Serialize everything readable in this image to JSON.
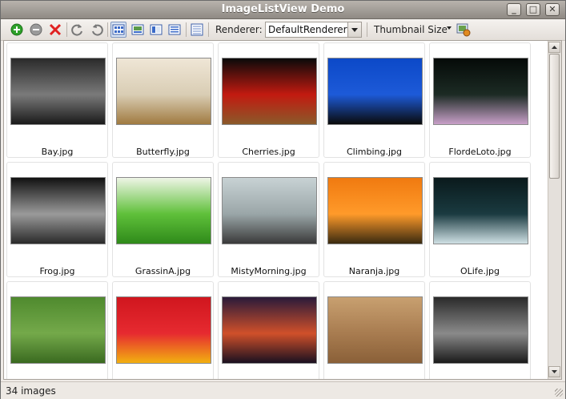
{
  "window": {
    "title": "ImageListView Demo",
    "controls": [
      "_",
      "□",
      "✕"
    ]
  },
  "toolbar": {
    "buttons": [
      {
        "name": "add-button",
        "icon": "plus-circle-icon",
        "color": "#2ea12a"
      },
      {
        "name": "remove-button",
        "icon": "minus-circle-icon",
        "color": "#8c8c8c"
      },
      {
        "name": "clear-button",
        "icon": "red-x-icon",
        "color": "#e02020"
      },
      {
        "name": "rotate-ccw-button",
        "icon": "rotate-ccw-icon",
        "color": "#777777"
      },
      {
        "name": "rotate-cw-button",
        "icon": "rotate-cw-icon",
        "color": "#777777"
      },
      {
        "name": "view-thumbnails-button",
        "icon": "thumbnails-view-icon",
        "active": true
      },
      {
        "name": "view-gallery-button",
        "icon": "gallery-view-icon"
      },
      {
        "name": "view-pane-button",
        "icon": "pane-view-icon"
      },
      {
        "name": "view-details-button",
        "icon": "details-view-icon"
      },
      {
        "name": "columns-button",
        "icon": "columns-icon"
      }
    ],
    "renderer_label": "Renderer:",
    "renderer_value": "DefaultRenderer",
    "thumbnail_size_label": "Thumbnail Size",
    "extra_icon": "image-settings-icon"
  },
  "images": [
    {
      "caption": "Bay.jpg",
      "colors": [
        "#2a2a2a",
        "#7a7a7a",
        "#1a1a1a"
      ]
    },
    {
      "caption": "Butterfly.jpg",
      "colors": [
        "#efe6d6",
        "#d9cdb4",
        "#a07a40"
      ]
    },
    {
      "caption": "Cherries.jpg",
      "colors": [
        "#0a0a0a",
        "#c21a10",
        "#8a5a2a"
      ]
    },
    {
      "caption": "Climbing.jpg",
      "colors": [
        "#0c49c8",
        "#1d5ad8",
        "#0a0a0a"
      ]
    },
    {
      "caption": "FlordeLoto.jpg",
      "colors": [
        "#050a08",
        "#1c2b24",
        "#c8a0c8"
      ]
    },
    {
      "caption": "Frog.jpg",
      "colors": [
        "#111111",
        "#9a9a9a",
        "#2a2a2a"
      ]
    },
    {
      "caption": "GrassinA.jpg",
      "colors": [
        "#eef5e6",
        "#5fc03a",
        "#2f8a1a"
      ]
    },
    {
      "caption": "MistyMorning.jpg",
      "colors": [
        "#c8d2d4",
        "#9aa6a8",
        "#3a3a3a"
      ]
    },
    {
      "caption": "Naranja.jpg",
      "colors": [
        "#f07a10",
        "#ff9a2a",
        "#3a2a10"
      ]
    },
    {
      "caption": "OLife.jpg",
      "colors": [
        "#0a1a1c",
        "#1a3a40",
        "#cfe0e4"
      ]
    },
    {
      "caption": "",
      "colors": [
        "#4f8a2e",
        "#74a94a",
        "#3a6a20"
      ]
    },
    {
      "caption": "",
      "colors": [
        "#d0161e",
        "#e62a30",
        "#f2b010"
      ]
    },
    {
      "caption": "",
      "colors": [
        "#2a1a3a",
        "#d0502a",
        "#1a1020"
      ]
    },
    {
      "caption": "",
      "colors": [
        "#c8a070",
        "#a87c50",
        "#8a6038"
      ]
    },
    {
      "caption": "",
      "colors": [
        "#2a2a2a",
        "#8a8a8a",
        "#1a1a1a"
      ]
    }
  ],
  "status": {
    "text": "34 images"
  }
}
